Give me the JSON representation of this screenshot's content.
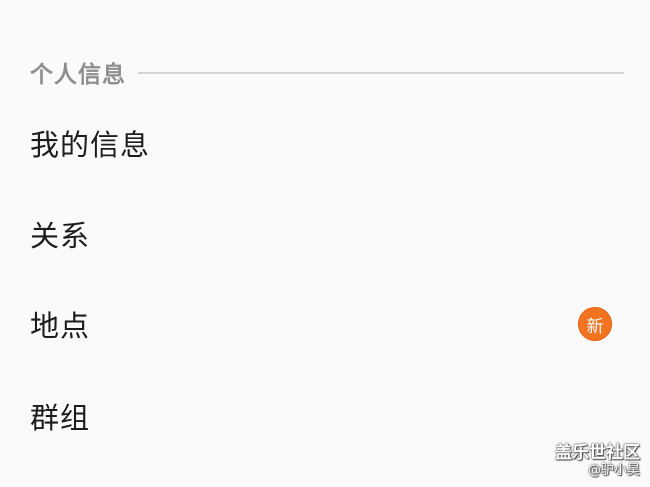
{
  "section": {
    "title": "个人信息"
  },
  "items": [
    {
      "label": "我的信息"
    },
    {
      "label": "关系"
    },
    {
      "label": "地点",
      "badge": "新"
    },
    {
      "label": "群组"
    }
  ],
  "colors": {
    "badge": "#f27320",
    "section_title": "#8e8e8e",
    "divider": "#d4d4d4",
    "background": "#fafafa"
  },
  "watermark": {
    "title": "盖乐世社区",
    "user": "@驴小昊"
  }
}
